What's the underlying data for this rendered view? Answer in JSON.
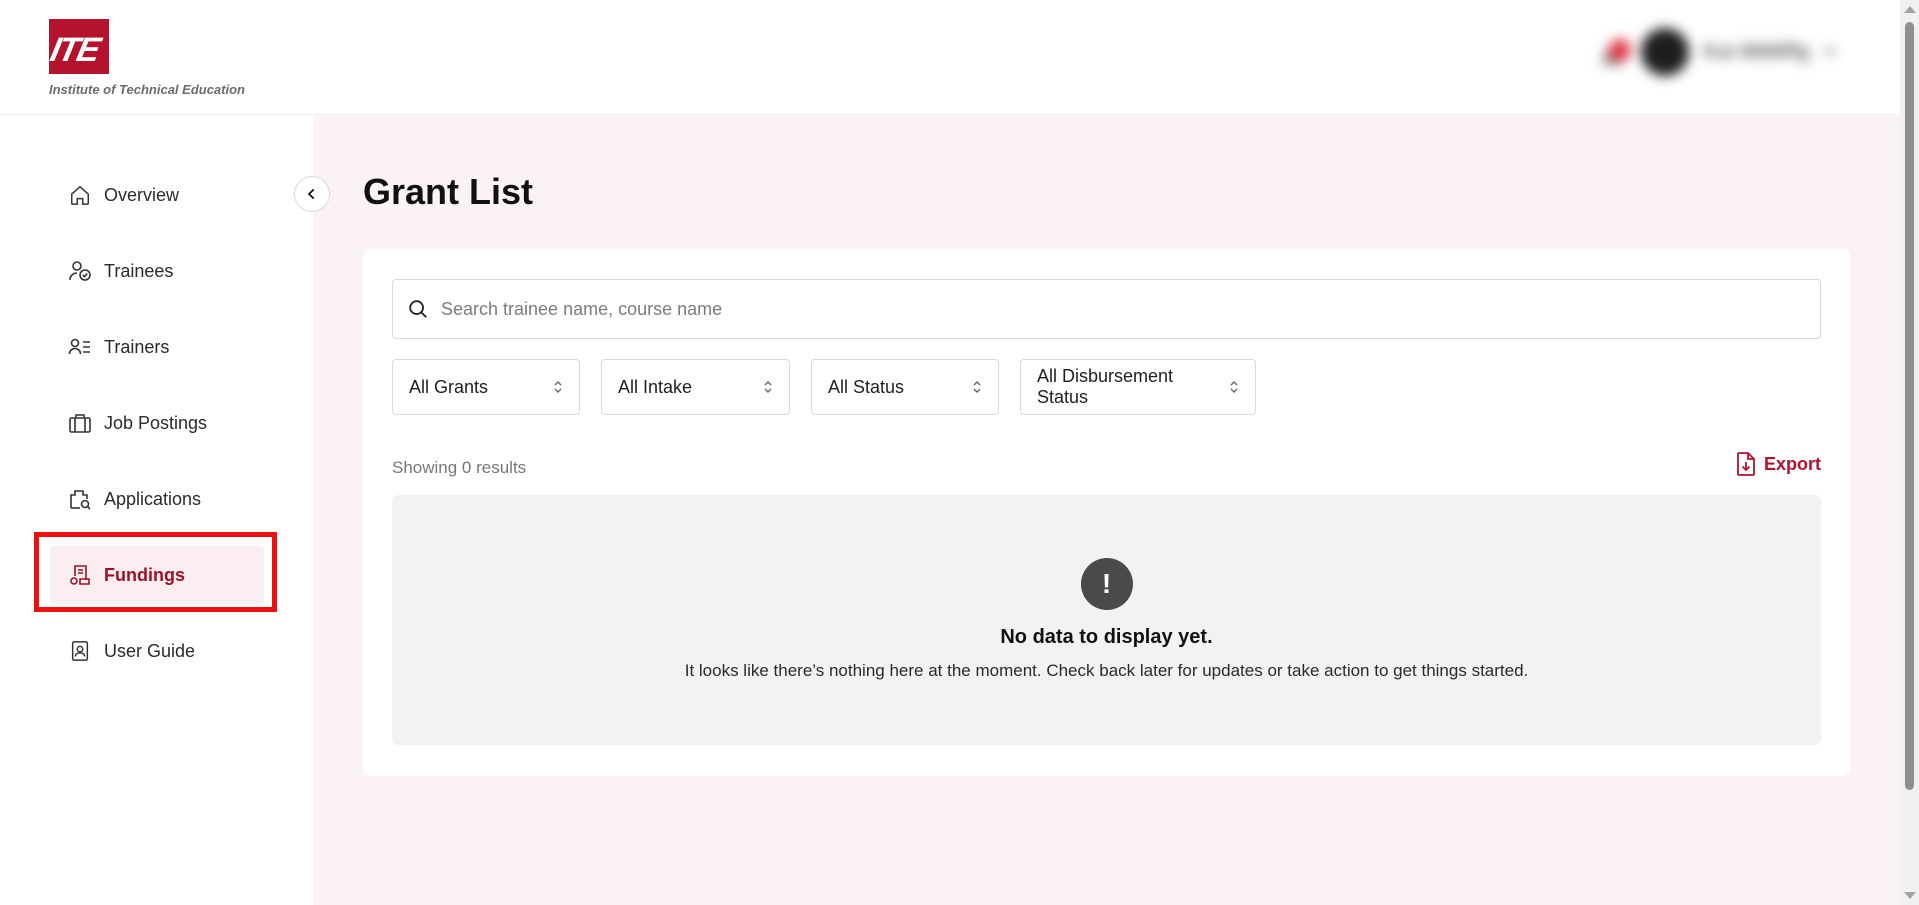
{
  "brand": {
    "logo_letters": "ITE",
    "name": "Institute of Technical Education",
    "color": "#b5132d"
  },
  "header": {
    "user_name": "Kai 8888ffg"
  },
  "sidebar": {
    "items": [
      {
        "label": "Overview",
        "icon": "home-icon"
      },
      {
        "label": "Trainees",
        "icon": "trainee-icon"
      },
      {
        "label": "Trainers",
        "icon": "trainers-icon"
      },
      {
        "label": "Job Postings",
        "icon": "briefcase-icon"
      },
      {
        "label": "Applications",
        "icon": "applications-icon"
      },
      {
        "label": "Fundings",
        "icon": "fundings-icon",
        "active": true
      },
      {
        "label": "User Guide",
        "icon": "user-guide-icon"
      }
    ]
  },
  "main": {
    "title": "Grant List",
    "search_placeholder": "Search trainee name, course name",
    "filters": [
      "All Grants",
      "All Intake",
      "All Status",
      "All Disbursement Status"
    ],
    "results_text": "Showing 0 results",
    "export_label": "Export",
    "empty": {
      "icon": "!",
      "title": "No data to display yet.",
      "description": "It looks like there’s nothing here at the moment. Check back later for updates or take action to get things started."
    }
  },
  "colors": {
    "accent": "#b3122e",
    "active_bg": "#fbeef0",
    "main_bg": "#faf2f3",
    "highlight_outline": "#ee1111"
  }
}
